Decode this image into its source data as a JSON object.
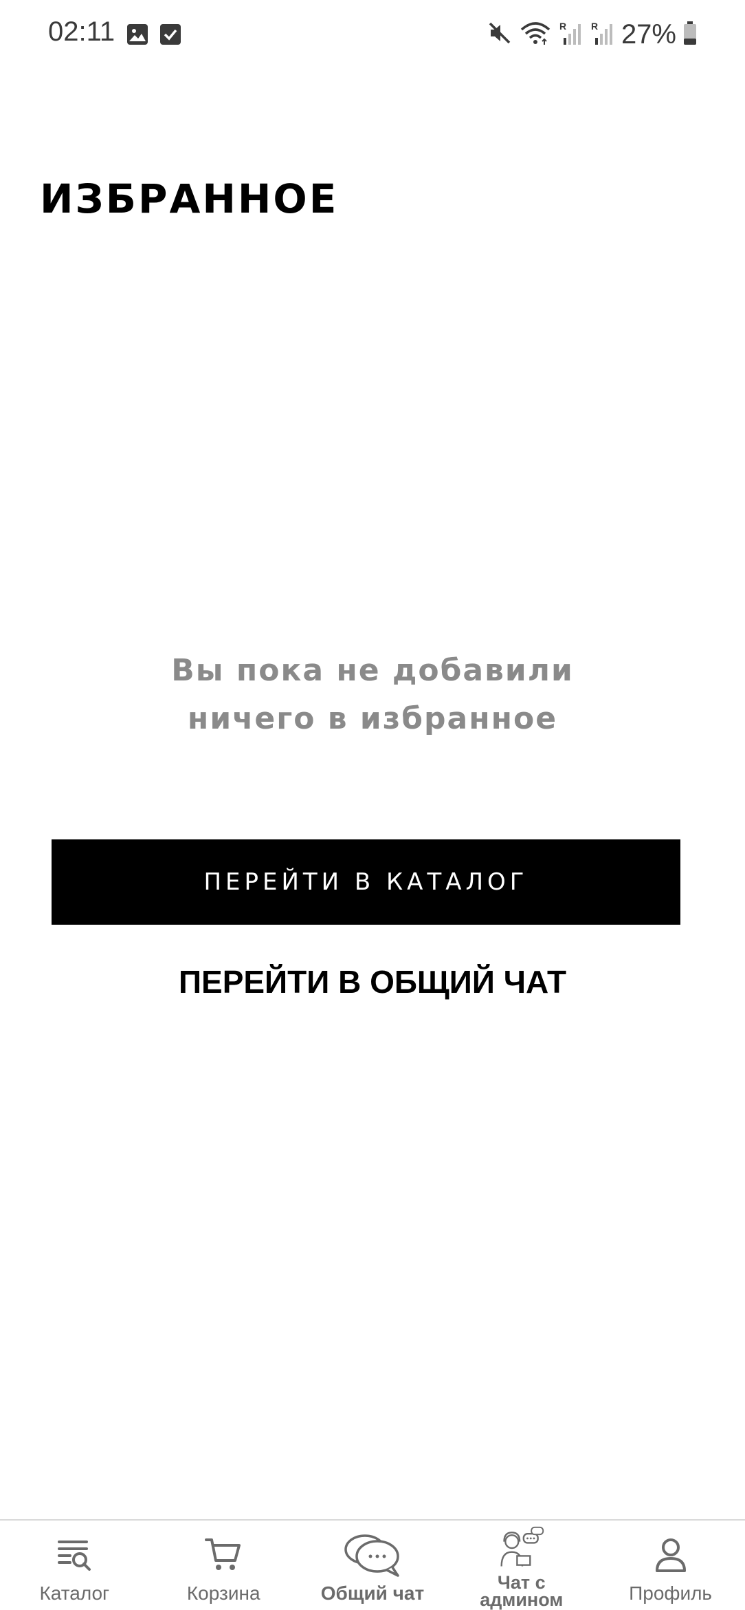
{
  "status_bar": {
    "time": "02:11",
    "battery": "27%",
    "icons": [
      "gallery-icon",
      "checkbox-icon",
      "mute-icon",
      "wifi-icon",
      "signal-r-icon",
      "signal-r-icon",
      "battery-icon"
    ]
  },
  "page": {
    "title": "ИЗБРАННОЕ",
    "empty_line1": "Вы пока не добавили",
    "empty_line2": "ничего в избранное",
    "catalog_button": "ПЕРЕЙТИ В КАТАЛОГ",
    "chat_link": "ПЕРЕЙТИ В ОБЩИЙ ЧАТ"
  },
  "bottom_nav": {
    "items": [
      {
        "label": "Каталог",
        "icon": "catalog-search-icon"
      },
      {
        "label": "Корзина",
        "icon": "cart-icon"
      },
      {
        "label": "Общий чат",
        "icon": "chat-bubbles-icon"
      },
      {
        "label": "Чат с админом",
        "icon": "admin-support-icon"
      },
      {
        "label": "Профиль",
        "icon": "profile-icon"
      }
    ]
  },
  "colors": {
    "accent": "#000000",
    "muted_text": "#8a8a8a",
    "nav_text": "#6b6b6b"
  }
}
